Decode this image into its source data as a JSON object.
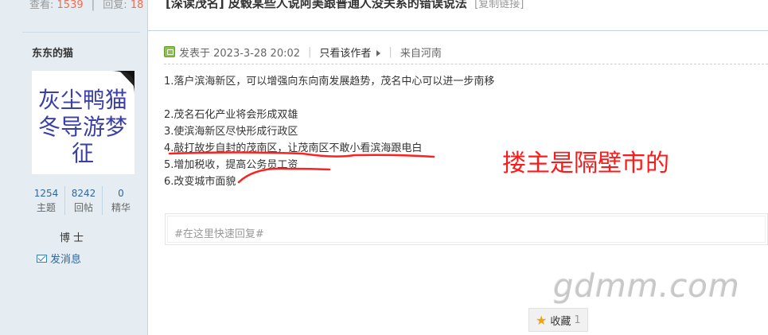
{
  "header": {
    "views_label": "查看:",
    "views": "1539",
    "replies_label": "回复:",
    "replies": "18",
    "thread_title": "[深读茂名] 皮毂某些人说阿美跟普通人没关系的错误说法",
    "copy_link": "[复制链接]"
  },
  "user": {
    "name": "东东的猫",
    "avatar_lines": [
      "灰尘鸭猫",
      "冬导游梦",
      "征"
    ],
    "stats": [
      {
        "value": "1254",
        "label": "主题"
      },
      {
        "value": "8242",
        "label": "回帖"
      },
      {
        "value": "0",
        "label": "精华"
      }
    ],
    "rank": "博 士",
    "send_message": "发消息"
  },
  "post": {
    "posted_at": "发表于 2023-3-28 20:02",
    "only_author": "只看该作者",
    "location": "来自河南",
    "lines": [
      "1.落户滨海新区，可以增强向东向南发展趋势，茂名中心可以进一步南移",
      "",
      "2.茂名石化产业将会形成双雄",
      "3.使滨海新区尽快形成行政区",
      "4.敲打故步自封的茂南区，让茂南区不敢小看滨海跟电白",
      "5.增加税收，提高公务员工资",
      "6.改变城市面貌"
    ],
    "annotation": "搂主是隔壁市的"
  },
  "quick_reply": {
    "placeholder": "#在这里快速回复#"
  },
  "watermark": "gdmm.com",
  "favorite": {
    "label": "收藏",
    "count": "1"
  },
  "colors": {
    "sidebar_bg": "#e5edf2",
    "link_blue": "#336699",
    "annotation_red": "#ff1a1a",
    "count_orange": "#f26c4f"
  }
}
